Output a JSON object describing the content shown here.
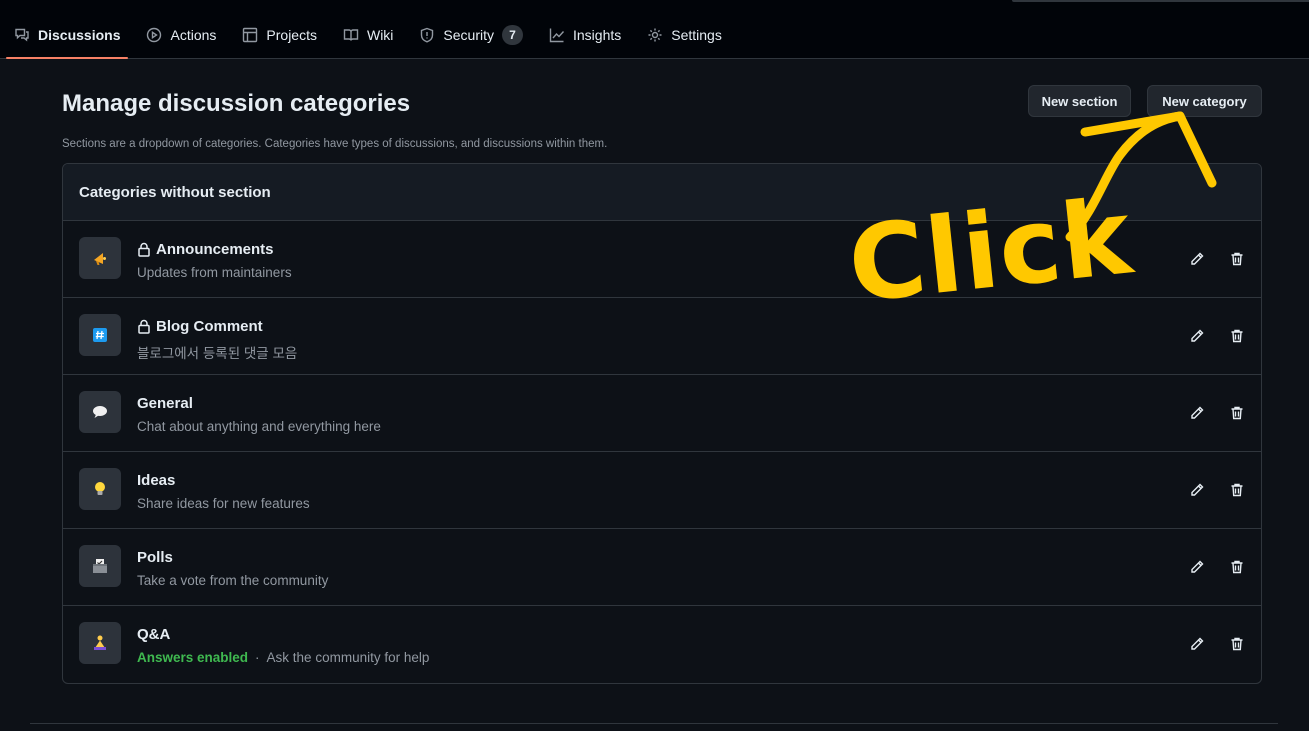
{
  "nav": {
    "tabs": [
      {
        "label": "Discussions",
        "icon": "discussions-icon",
        "active": true
      },
      {
        "label": "Actions",
        "icon": "play-icon"
      },
      {
        "label": "Projects",
        "icon": "table-icon"
      },
      {
        "label": "Wiki",
        "icon": "book-icon"
      },
      {
        "label": "Security",
        "icon": "shield-icon",
        "counter": "7"
      },
      {
        "label": "Insights",
        "icon": "graph-icon"
      },
      {
        "label": "Settings",
        "icon": "gear-icon"
      }
    ]
  },
  "page": {
    "title": "Manage discussion categories",
    "subtitle": "Sections are a dropdown of categories. Categories have types of discussions, and discussions within them.",
    "new_section_label": "New section",
    "new_category_label": "New category"
  },
  "box": {
    "header": "Categories without section",
    "categories": [
      {
        "name": "Announcements",
        "desc": "Updates from maintainers",
        "emoji": "📣",
        "locked": true
      },
      {
        "name": "Blog Comment",
        "desc": "블로그에서 등록된 댓글 모음",
        "emoji": "#️⃣",
        "locked": true
      },
      {
        "name": "General",
        "desc": "Chat about anything and everything here",
        "emoji": "💬",
        "locked": false
      },
      {
        "name": "Ideas",
        "desc": "Share ideas for new features",
        "emoji": "💡",
        "locked": false
      },
      {
        "name": "Polls",
        "desc": "Take a vote from the community",
        "emoji": "🗳️",
        "locked": false
      },
      {
        "name": "Q&A",
        "desc": "Ask the community for help",
        "answers_label": "Answers enabled",
        "separator": "·",
        "emoji": "🙏",
        "locked": false
      }
    ]
  },
  "annotation": {
    "text": "Click",
    "color": "#ffc800"
  },
  "colors": {
    "background": "#0d1117",
    "border": "#30363d",
    "active_tab_underline": "#f78166",
    "answers_green": "#3fb950"
  }
}
